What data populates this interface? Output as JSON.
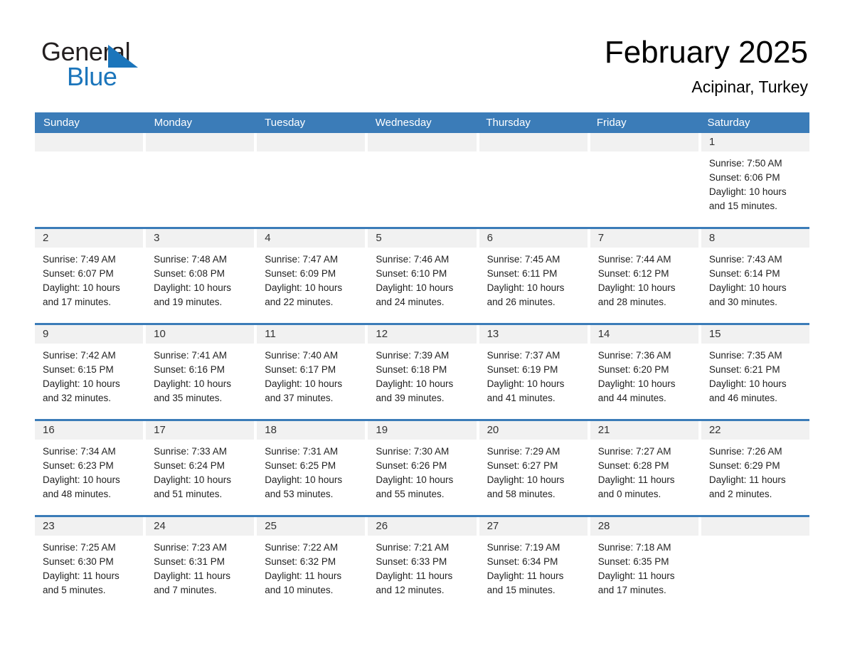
{
  "brand": {
    "name_part1": "General",
    "name_part2": "Blue",
    "triangle_color": "#1b75bb"
  },
  "header": {
    "title": "February 2025",
    "subtitle": "Acipinar, Turkey"
  },
  "theme": {
    "header_blue": "#3b7cb8",
    "date_band": "#f1f1f1",
    "text": "#222222"
  },
  "weekdays": [
    "Sunday",
    "Monday",
    "Tuesday",
    "Wednesday",
    "Thursday",
    "Friday",
    "Saturday"
  ],
  "weeks": [
    [
      {
        "day": "",
        "lines": []
      },
      {
        "day": "",
        "lines": []
      },
      {
        "day": "",
        "lines": []
      },
      {
        "day": "",
        "lines": []
      },
      {
        "day": "",
        "lines": []
      },
      {
        "day": "",
        "lines": []
      },
      {
        "day": "1",
        "lines": [
          "Sunrise: 7:50 AM",
          "Sunset: 6:06 PM",
          "Daylight: 10 hours",
          "and 15 minutes."
        ]
      }
    ],
    [
      {
        "day": "2",
        "lines": [
          "Sunrise: 7:49 AM",
          "Sunset: 6:07 PM",
          "Daylight: 10 hours",
          "and 17 minutes."
        ]
      },
      {
        "day": "3",
        "lines": [
          "Sunrise: 7:48 AM",
          "Sunset: 6:08 PM",
          "Daylight: 10 hours",
          "and 19 minutes."
        ]
      },
      {
        "day": "4",
        "lines": [
          "Sunrise: 7:47 AM",
          "Sunset: 6:09 PM",
          "Daylight: 10 hours",
          "and 22 minutes."
        ]
      },
      {
        "day": "5",
        "lines": [
          "Sunrise: 7:46 AM",
          "Sunset: 6:10 PM",
          "Daylight: 10 hours",
          "and 24 minutes."
        ]
      },
      {
        "day": "6",
        "lines": [
          "Sunrise: 7:45 AM",
          "Sunset: 6:11 PM",
          "Daylight: 10 hours",
          "and 26 minutes."
        ]
      },
      {
        "day": "7",
        "lines": [
          "Sunrise: 7:44 AM",
          "Sunset: 6:12 PM",
          "Daylight: 10 hours",
          "and 28 minutes."
        ]
      },
      {
        "day": "8",
        "lines": [
          "Sunrise: 7:43 AM",
          "Sunset: 6:14 PM",
          "Daylight: 10 hours",
          "and 30 minutes."
        ]
      }
    ],
    [
      {
        "day": "9",
        "lines": [
          "Sunrise: 7:42 AM",
          "Sunset: 6:15 PM",
          "Daylight: 10 hours",
          "and 32 minutes."
        ]
      },
      {
        "day": "10",
        "lines": [
          "Sunrise: 7:41 AM",
          "Sunset: 6:16 PM",
          "Daylight: 10 hours",
          "and 35 minutes."
        ]
      },
      {
        "day": "11",
        "lines": [
          "Sunrise: 7:40 AM",
          "Sunset: 6:17 PM",
          "Daylight: 10 hours",
          "and 37 minutes."
        ]
      },
      {
        "day": "12",
        "lines": [
          "Sunrise: 7:39 AM",
          "Sunset: 6:18 PM",
          "Daylight: 10 hours",
          "and 39 minutes."
        ]
      },
      {
        "day": "13",
        "lines": [
          "Sunrise: 7:37 AM",
          "Sunset: 6:19 PM",
          "Daylight: 10 hours",
          "and 41 minutes."
        ]
      },
      {
        "day": "14",
        "lines": [
          "Sunrise: 7:36 AM",
          "Sunset: 6:20 PM",
          "Daylight: 10 hours",
          "and 44 minutes."
        ]
      },
      {
        "day": "15",
        "lines": [
          "Sunrise: 7:35 AM",
          "Sunset: 6:21 PM",
          "Daylight: 10 hours",
          "and 46 minutes."
        ]
      }
    ],
    [
      {
        "day": "16",
        "lines": [
          "Sunrise: 7:34 AM",
          "Sunset: 6:23 PM",
          "Daylight: 10 hours",
          "and 48 minutes."
        ]
      },
      {
        "day": "17",
        "lines": [
          "Sunrise: 7:33 AM",
          "Sunset: 6:24 PM",
          "Daylight: 10 hours",
          "and 51 minutes."
        ]
      },
      {
        "day": "18",
        "lines": [
          "Sunrise: 7:31 AM",
          "Sunset: 6:25 PM",
          "Daylight: 10 hours",
          "and 53 minutes."
        ]
      },
      {
        "day": "19",
        "lines": [
          "Sunrise: 7:30 AM",
          "Sunset: 6:26 PM",
          "Daylight: 10 hours",
          "and 55 minutes."
        ]
      },
      {
        "day": "20",
        "lines": [
          "Sunrise: 7:29 AM",
          "Sunset: 6:27 PM",
          "Daylight: 10 hours",
          "and 58 minutes."
        ]
      },
      {
        "day": "21",
        "lines": [
          "Sunrise: 7:27 AM",
          "Sunset: 6:28 PM",
          "Daylight: 11 hours",
          "and 0 minutes."
        ]
      },
      {
        "day": "22",
        "lines": [
          "Sunrise: 7:26 AM",
          "Sunset: 6:29 PM",
          "Daylight: 11 hours",
          "and 2 minutes."
        ]
      }
    ],
    [
      {
        "day": "23",
        "lines": [
          "Sunrise: 7:25 AM",
          "Sunset: 6:30 PM",
          "Daylight: 11 hours",
          "and 5 minutes."
        ]
      },
      {
        "day": "24",
        "lines": [
          "Sunrise: 7:23 AM",
          "Sunset: 6:31 PM",
          "Daylight: 11 hours",
          "and 7 minutes."
        ]
      },
      {
        "day": "25",
        "lines": [
          "Sunrise: 7:22 AM",
          "Sunset: 6:32 PM",
          "Daylight: 11 hours",
          "and 10 minutes."
        ]
      },
      {
        "day": "26",
        "lines": [
          "Sunrise: 7:21 AM",
          "Sunset: 6:33 PM",
          "Daylight: 11 hours",
          "and 12 minutes."
        ]
      },
      {
        "day": "27",
        "lines": [
          "Sunrise: 7:19 AM",
          "Sunset: 6:34 PM",
          "Daylight: 11 hours",
          "and 15 minutes."
        ]
      },
      {
        "day": "28",
        "lines": [
          "Sunrise: 7:18 AM",
          "Sunset: 6:35 PM",
          "Daylight: 11 hours",
          "and 17 minutes."
        ]
      },
      {
        "day": "",
        "lines": []
      }
    ]
  ]
}
